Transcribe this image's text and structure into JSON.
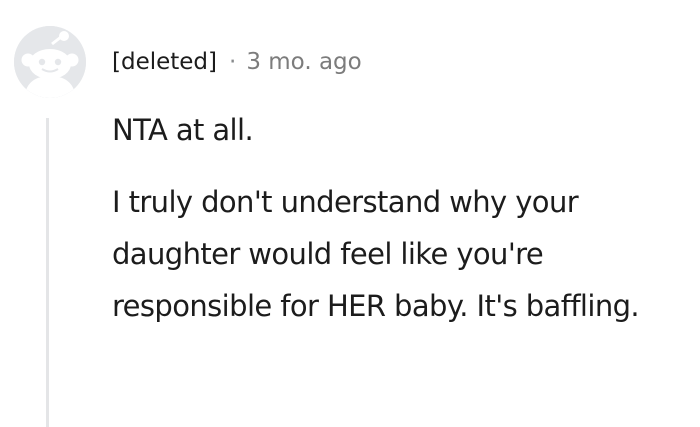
{
  "comment": {
    "author": "[deleted]",
    "separator": "·",
    "time_ago": "3 mo. ago",
    "avatar_icon": "snoo-avatar-icon",
    "paragraphs": [
      "NTA at all.",
      "I truly don't understand why your daughter would feel like you're responsible for HER baby. It's baffling."
    ]
  },
  "colors": {
    "text": "#1c1c1c",
    "meta": "#7c7c7c",
    "thread_line": "#e4e5e7",
    "avatar_bg": "#e5e7ea"
  }
}
